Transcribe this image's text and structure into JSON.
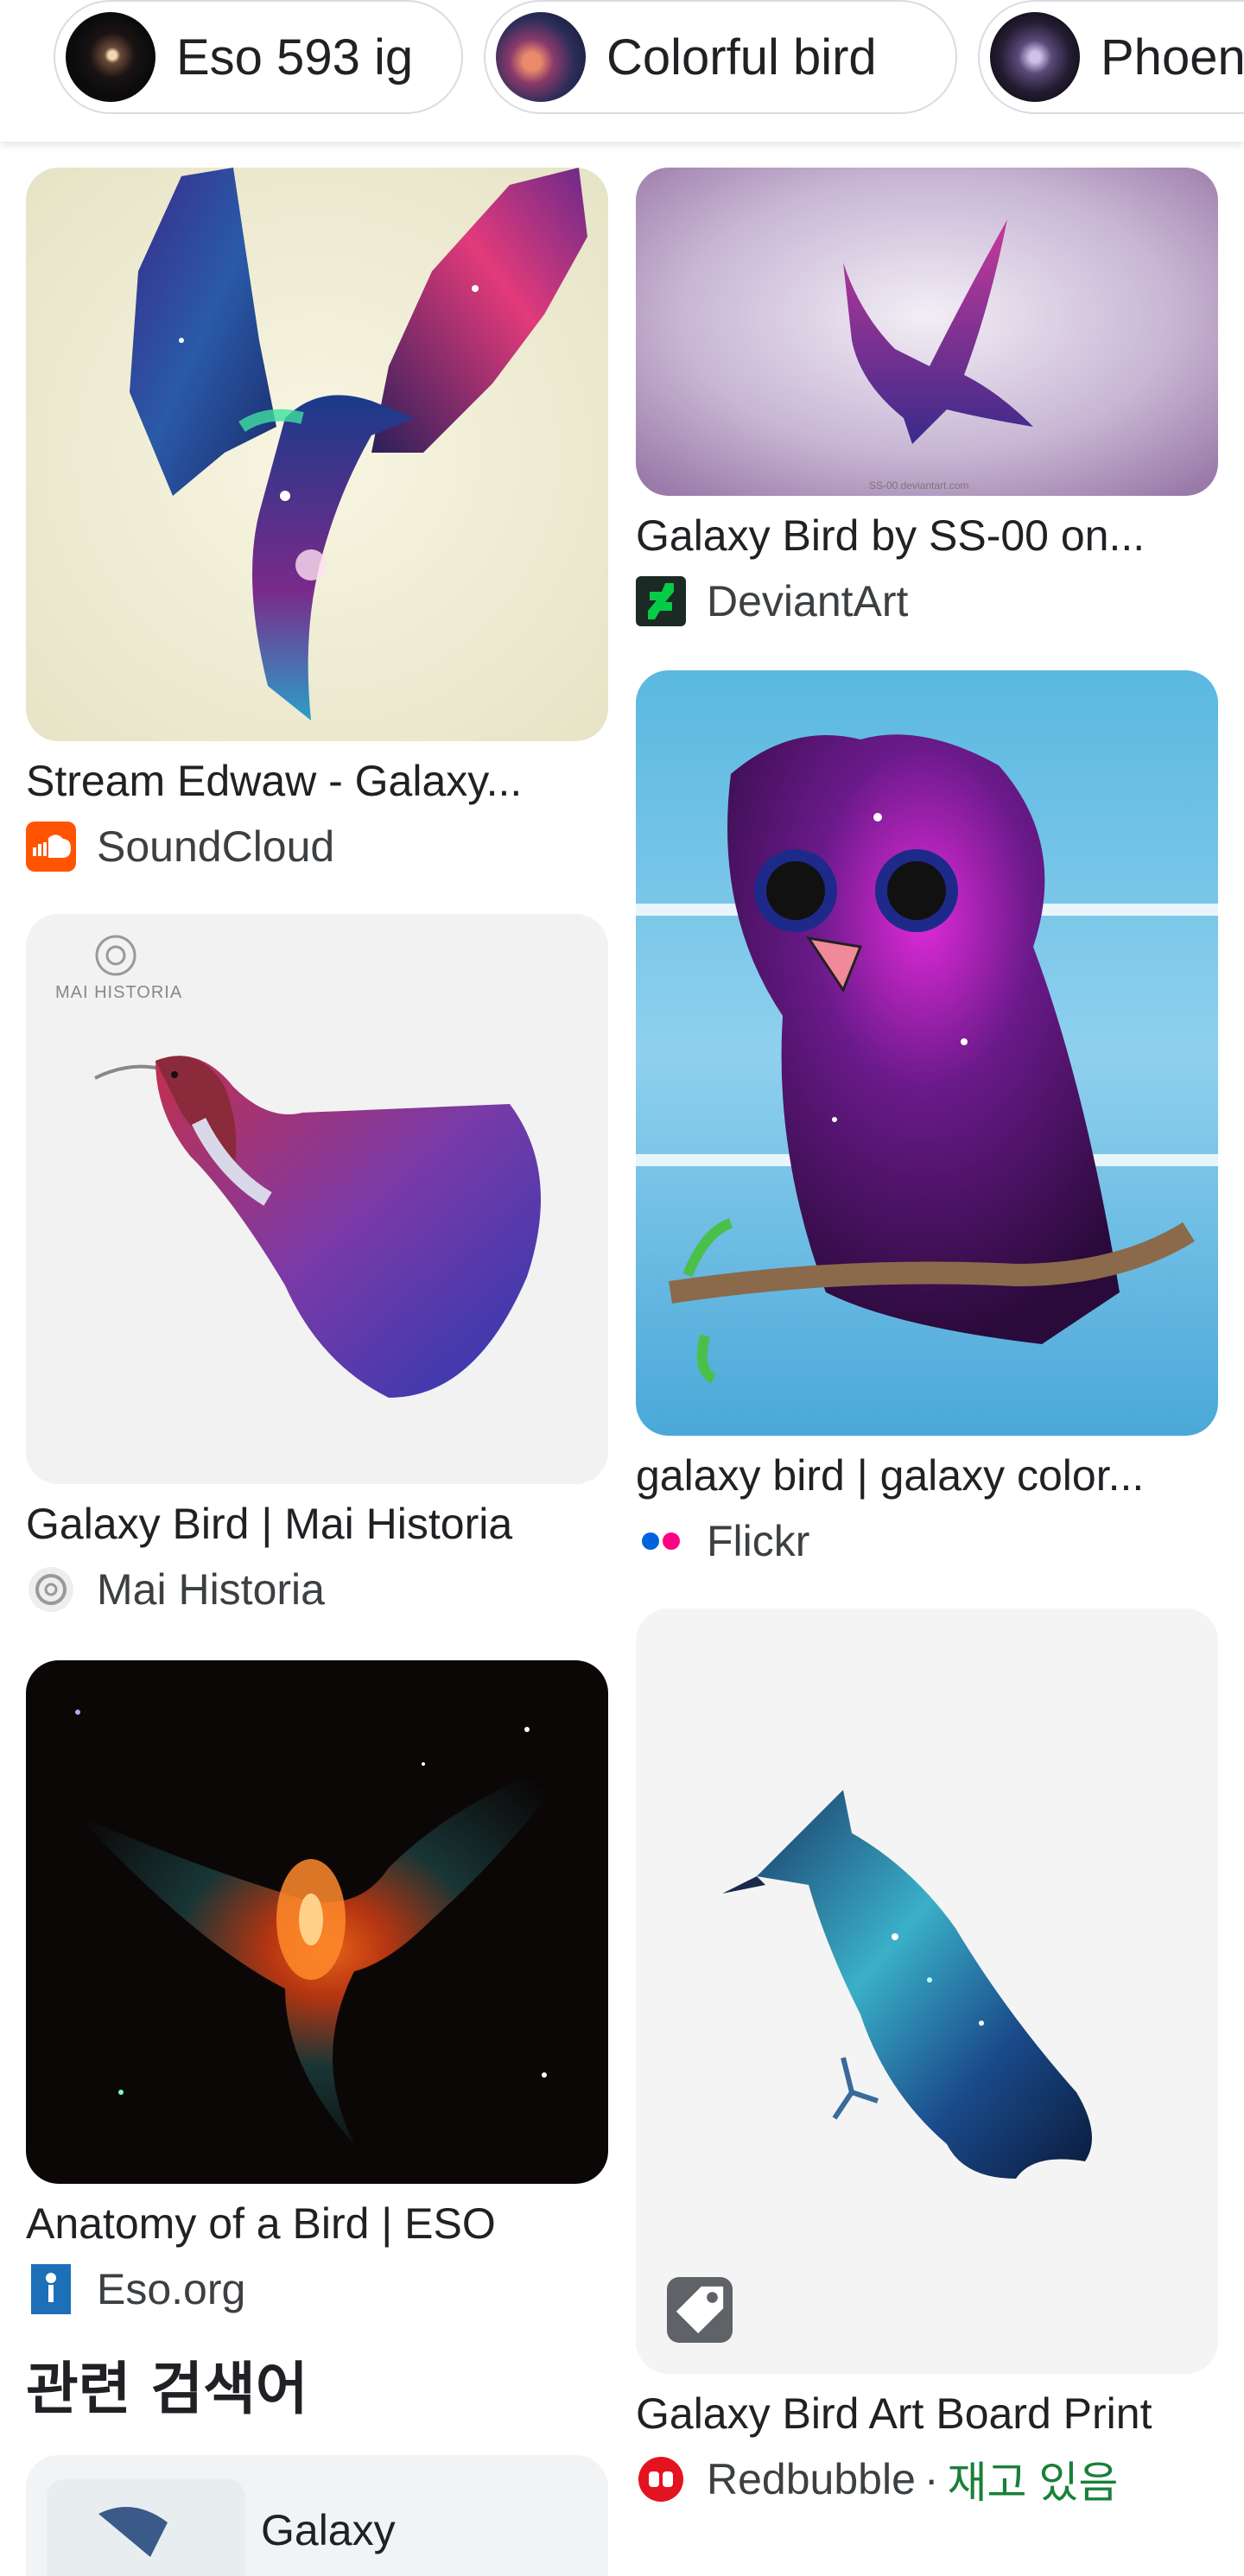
{
  "chips": [
    {
      "label": "Eso 593 ig",
      "thumb_icon": "eso-593-nebula-thumbnail"
    },
    {
      "label": "Colorful bird",
      "thumb_icon": "colorful-bird-thumbnail"
    },
    {
      "label": "Phoen",
      "thumb_icon": "phoenix-thumbnail"
    }
  ],
  "results": [
    {
      "title": "Stream Edwaw - Galaxy...",
      "source": "SoundCloud",
      "source_icon": "soundcloud-icon",
      "image_icon": "galaxy-hummingbird-image"
    },
    {
      "title": "Galaxy Bird by SS-00 on...",
      "source": "DeviantArt",
      "source_icon": "deviantart-icon",
      "image_icon": "galaxy-bird-silhouette-image"
    },
    {
      "title": "galaxy bird | galaxy color...",
      "source": "Flickr",
      "source_icon": "flickr-icon",
      "image_icon": "galaxy-owl-cartoon-image"
    },
    {
      "title": "Galaxy Bird | Mai Historia",
      "source": "Mai Historia",
      "source_icon": "mai-historia-icon",
      "image_icon": "feathered-bird-image",
      "watermark": "MAI HISTORIA"
    },
    {
      "title": "Anatomy of a Bird | ESO",
      "source": "Eso.org",
      "source_icon": "eso-icon",
      "image_icon": "nebula-bird-image"
    },
    {
      "title": "Galaxy Bird Art Board Print",
      "source": "Redbubble",
      "source_icon": "redbubble-icon",
      "image_icon": "galaxy-bluejay-image",
      "stock": "재고 있음",
      "separator": "·"
    }
  ],
  "related": {
    "heading": "관련 검색어",
    "items": [
      {
        "label": "Galaxy"
      }
    ]
  },
  "colors": {
    "in_stock": "#188038",
    "soundcloud": "#ff5500",
    "deviantart": "#05cc47",
    "flickr_blue": "#0063dc",
    "flickr_pink": "#ff0084",
    "redbubble": "#e41321"
  }
}
